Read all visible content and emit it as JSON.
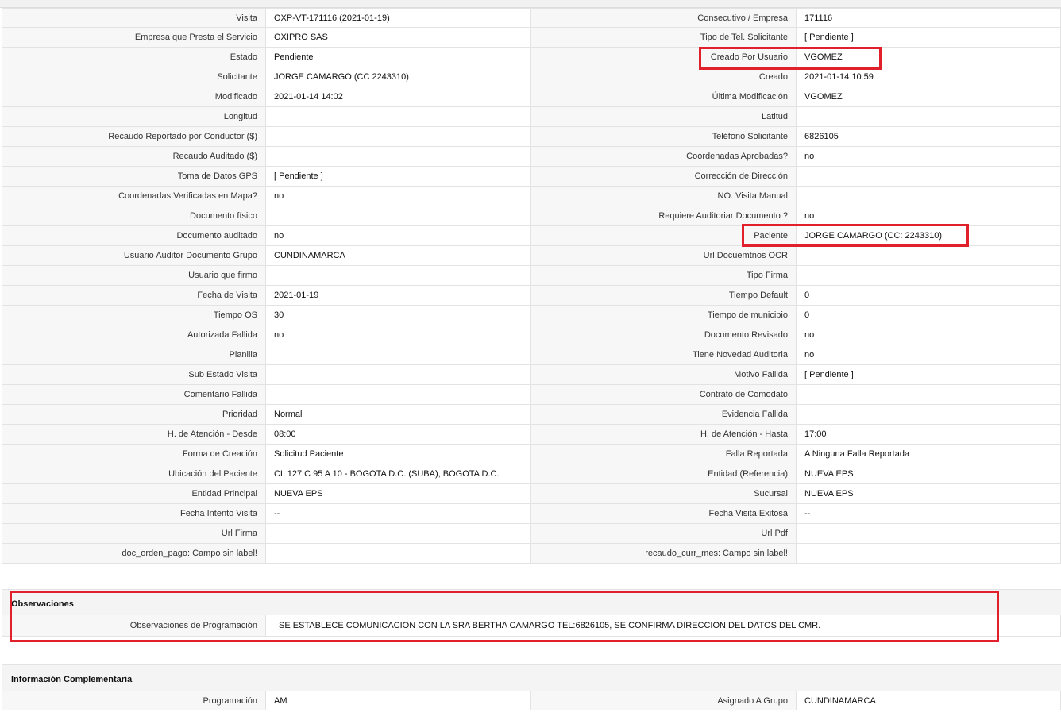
{
  "main_rows": [
    [
      "Visita",
      "OXP-VT-171116 (2021-01-19)",
      "Consecutivo / Empresa",
      "171116"
    ],
    [
      "Empresa que Presta el Servicio",
      "OXIPRO SAS",
      "Tipo de Tel. Solicitante",
      "[ Pendiente ]"
    ],
    [
      "Estado",
      "Pendiente",
      "Creado Por Usuario",
      "VGOMEZ"
    ],
    [
      "Solicitante",
      "JORGE CAMARGO (CC 2243310)",
      "Creado",
      "2021-01-14 10:59"
    ],
    [
      "Modificado",
      "2021-01-14 14:02",
      "Última Modificación",
      " VGOMEZ"
    ],
    [
      "Longitud",
      "",
      "Latitud",
      ""
    ],
    [
      "Recaudo Reportado por Conductor ($)",
      "",
      "Teléfono Solicitante",
      "6826105"
    ],
    [
      "Recaudo Auditado ($)",
      "",
      "Coordenadas Aprobadas?",
      " no"
    ],
    [
      "Toma de Datos GPS",
      "[ Pendiente ]",
      "Corrección de Dirección",
      ""
    ],
    [
      "Coordenadas Verificadas en Mapa?",
      " no",
      "NO. Visita Manual",
      ""
    ],
    [
      "Documento físico",
      "",
      "Requiere Auditoriar Documento ?",
      " no"
    ],
    [
      "Documento auditado",
      " no",
      "Paciente",
      "JORGE CAMARGO (CC: 2243310)"
    ],
    [
      "Usuario Auditor Documento Grupo",
      "CUNDINAMARCA",
      "Url Docuemtnos OCR",
      ""
    ],
    [
      "Usuario que firmo",
      "",
      "Tipo Firma",
      ""
    ],
    [
      "Fecha de Visita",
      " 2021-01-19",
      "Tiempo Default",
      "0"
    ],
    [
      "Tiempo OS",
      "30",
      "Tiempo de municipio",
      "0"
    ],
    [
      "Autorizada Fallida",
      " no",
      "Documento Revisado",
      " no"
    ],
    [
      "Planilla",
      "",
      "Tiene Novedad Auditoria",
      " no"
    ],
    [
      "Sub Estado Visita",
      "",
      "Motivo Fallida",
      "[ Pendiente ]"
    ],
    [
      "Comentario Fallida",
      "",
      "Contrato de Comodato",
      ""
    ],
    [
      "Prioridad",
      "Normal",
      "Evidencia Fallida",
      ""
    ],
    [
      "H. de Atención - Desde",
      "08:00",
      "H. de Atención - Hasta",
      "17:00"
    ],
    [
      "Forma de Creación",
      "Solicitud Paciente",
      "Falla Reportada",
      "A Ninguna Falla Reportada"
    ],
    [
      "Ubicación del Paciente",
      "CL 127 C 95 A 10 - BOGOTA D.C. (SUBA), BOGOTA D.C.",
      "Entidad (Referencia)",
      "NUEVA EPS"
    ],
    [
      "Entidad Principal",
      "NUEVA EPS",
      "Sucursal",
      "NUEVA EPS"
    ],
    [
      "Fecha Intento Visita",
      " --",
      "Fecha Visita Exitosa",
      " --"
    ],
    [
      "Url Firma",
      "",
      "Url Pdf",
      ""
    ],
    [
      "doc_orden_pago: Campo sin label!",
      "",
      "recaudo_curr_mes: Campo sin label!",
      ""
    ]
  ],
  "observaciones": {
    "title": "Observaciones",
    "label": "Observaciones de Programación",
    "value": "SE ESTABLECE COMUNICACION CON LA SRA BERTHA CAMARGO TEL:6826105, SE CONFIRMA DIRECCION DEL DATOS DEL CMR."
  },
  "complementaria": {
    "title": "Información Complementaria",
    "rows": [
      [
        "Programación",
        "AM",
        "Asignado A Grupo",
        "CUNDINAMARCA"
      ]
    ]
  },
  "highlight_color": "#e0202a"
}
